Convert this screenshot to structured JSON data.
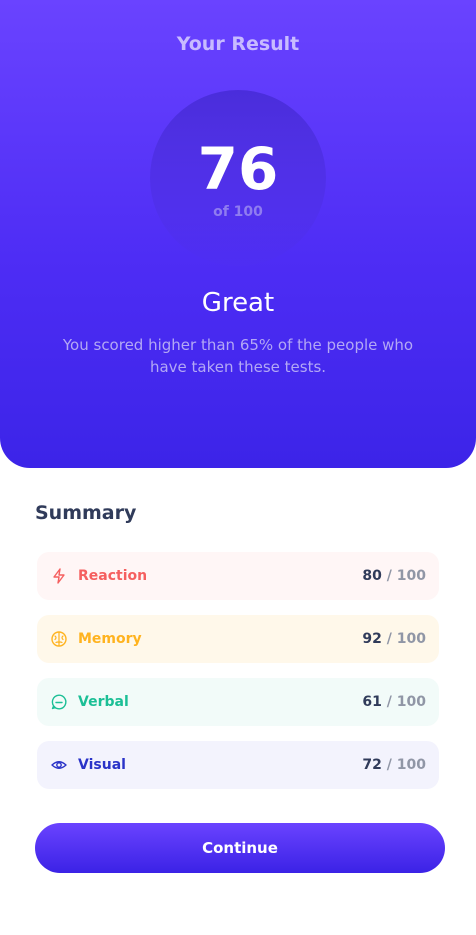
{
  "result": {
    "title": "Your Result",
    "score": "76",
    "score_of": "of 100",
    "rating": "Great",
    "description": "You scored higher than 65% of the people who have taken these tests."
  },
  "summary": {
    "title": "Summary",
    "items": [
      {
        "label": "Reaction",
        "score": "80",
        "separator": "/",
        "max": "100",
        "icon": "lightning-icon",
        "color": "#f55f5f"
      },
      {
        "label": "Memory",
        "score": "92",
        "separator": "/",
        "max": "100",
        "icon": "brain-icon",
        "color": "#ffb31f"
      },
      {
        "label": "Verbal",
        "score": "61",
        "separator": "/",
        "max": "100",
        "icon": "chat-bubble-icon",
        "color": "#1cbf96"
      },
      {
        "label": "Visual",
        "score": "72",
        "separator": "/",
        "max": "100",
        "icon": "eye-icon",
        "color": "#2a33c8"
      }
    ]
  },
  "actions": {
    "continue_label": "Continue"
  },
  "colors": {
    "accent_start": "#6a43ff",
    "accent_end": "#3b22e6"
  }
}
